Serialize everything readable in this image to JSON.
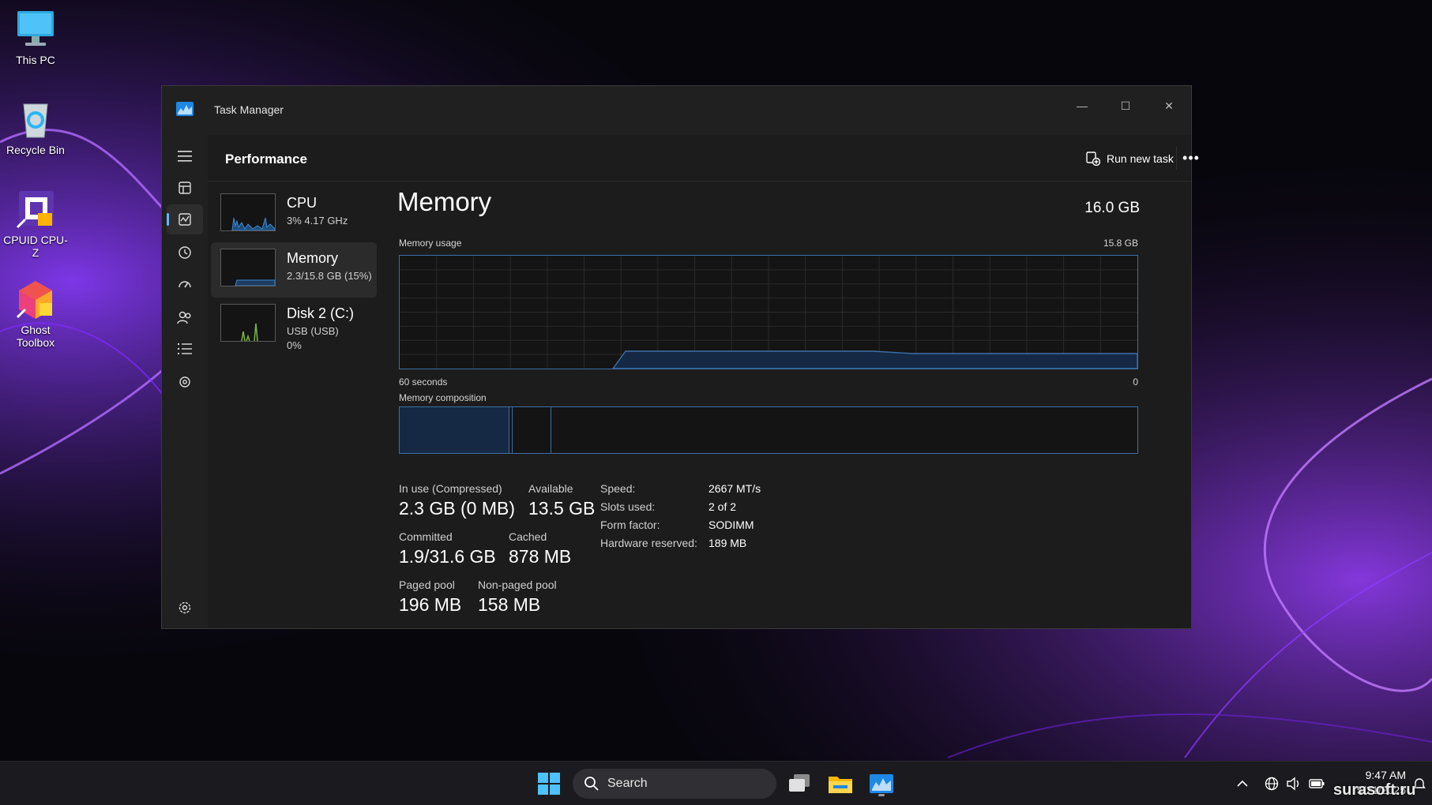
{
  "desktop": {
    "icons": [
      {
        "label": "This PC",
        "icon": "monitor-icon"
      },
      {
        "label": "Recycle Bin",
        "icon": "recycle-bin-icon"
      },
      {
        "label": "CPUID CPU-Z",
        "icon": "cpu-z-icon"
      },
      {
        "label": "Ghost Toolbox",
        "icon": "ghost-toolbox-icon"
      }
    ]
  },
  "window": {
    "title": "Task Manager",
    "controls": {
      "minimize": "—",
      "maximize": "☐",
      "close": "✕"
    }
  },
  "header": {
    "page_title": "Performance",
    "run_new_task": "Run new task",
    "more": "•••"
  },
  "nav": [
    {
      "icon": "hamburger-menu-icon"
    },
    {
      "icon": "processes-icon"
    },
    {
      "icon": "performance-icon",
      "active": true
    },
    {
      "icon": "app-history-icon"
    },
    {
      "icon": "startup-apps-icon"
    },
    {
      "icon": "users-icon"
    },
    {
      "icon": "details-icon"
    },
    {
      "icon": "services-icon"
    },
    {
      "icon": "settings-icon"
    }
  ],
  "resources": [
    {
      "name": "CPU",
      "sub1": "3%  4.17 GHz",
      "sub2": ""
    },
    {
      "name": "Memory",
      "sub1": "2.3/15.8 GB (15%)",
      "sub2": "",
      "selected": true
    },
    {
      "name": "Disk 2 (C:)",
      "sub1": "USB (USB)",
      "sub2": "0%"
    }
  ],
  "memory": {
    "heading": "Memory",
    "total": "16.0 GB",
    "usage_label": "Memory usage",
    "usage_max": "15.8 GB",
    "axis_left": "60 seconds",
    "axis_right": "0",
    "composition_label": "Memory composition",
    "stats": {
      "in_use_label": "In use (Compressed)",
      "in_use_value": "2.3 GB (0 MB)",
      "available_label": "Available",
      "available_value": "13.5 GB",
      "committed_label": "Committed",
      "committed_value": "1.9/31.6 GB",
      "cached_label": "Cached",
      "cached_value": "878 MB",
      "paged_label": "Paged pool",
      "paged_value": "196 MB",
      "nonpaged_label": "Non-paged pool",
      "nonpaged_value": "158 MB"
    },
    "specs": {
      "speed_key": "Speed:",
      "speed_val": "2667 MT/s",
      "slots_key": "Slots used:",
      "slots_val": "2 of 2",
      "form_key": "Form factor:",
      "form_val": "SODIMM",
      "reserved_key": "Hardware reserved:",
      "reserved_val": "189 MB"
    }
  },
  "taskbar": {
    "search_label": "Search",
    "clock_time": "9:47 AM",
    "clock_date": "5/21/2025"
  },
  "watermark": "surasoft.ru",
  "colors": {
    "accent": "#60b6ff",
    "graph_line": "#3c6fa8",
    "graph_fill": "#152944",
    "window_bg": "#1c1c1c"
  }
}
